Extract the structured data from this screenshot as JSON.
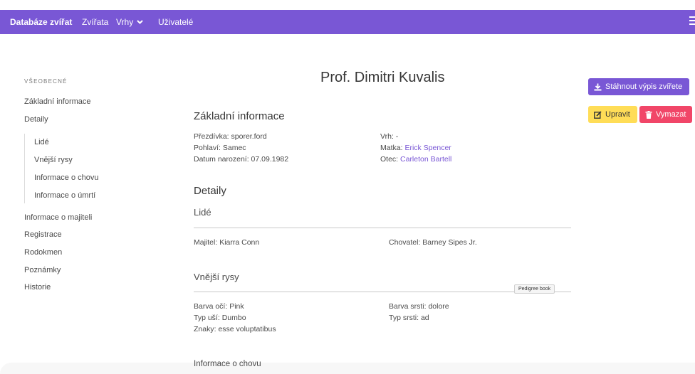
{
  "navbar": {
    "brand": "Databáze zvířat",
    "items": [
      {
        "label": "Zvířata"
      },
      {
        "label": "Vrhy"
      },
      {
        "label": "Uživatelé"
      }
    ]
  },
  "sidebar": {
    "section_label": "VŠEOBECNÉ",
    "items": [
      {
        "label": "Základní informace"
      },
      {
        "label": "Detaily"
      },
      {
        "label": "Lidé"
      },
      {
        "label": "Vnější rysy"
      },
      {
        "label": "Informace o chovu"
      },
      {
        "label": "Informace o úmrtí"
      },
      {
        "label": "Informace o majiteli"
      },
      {
        "label": "Registrace"
      },
      {
        "label": "Rodokmen"
      },
      {
        "label": "Poznámky"
      },
      {
        "label": "Historie"
      }
    ]
  },
  "main": {
    "title": "Prof. Dimitri Kuvalis",
    "basic_info": {
      "heading": "Základní informace",
      "nickname_label": "Přezdívka:",
      "nickname": "sporer.ford",
      "sex_label": "Pohlaví:",
      "sex": "Samec",
      "birth_label": "Datum narození:",
      "birth": "07.09.1982",
      "litter_label": "Vrh:",
      "litter": "-",
      "mother_label": "Matka:",
      "mother": "Erick Spencer",
      "father_label": "Otec:",
      "father": "Carleton Bartell"
    },
    "details": {
      "heading": "Detaily",
      "people": {
        "heading": "Lidé",
        "owner_label": "Majitel:",
        "owner": "Kiarra Conn",
        "breeder_label": "Chovatel:",
        "breeder": "Barney Sipes Jr."
      },
      "appearance": {
        "heading": "Vnější rysy",
        "eye_label": "Barva očí:",
        "eye": "Pink",
        "ear_label": "Typ uší:",
        "ear": "Dumbo",
        "marks_label": "Znaky:",
        "marks": "esse voluptatibus",
        "coat_color_label": "Barva srsti:",
        "coat_color": "dolore",
        "coat_type_label": "Typ srsti:",
        "coat_type": "ad"
      },
      "breeding_heading": "Informace o chovu"
    }
  },
  "actions": {
    "download": "Stáhnout výpis zvířete",
    "edit": "Upravit",
    "delete": "Vymazat"
  },
  "tooltip": "Pedigree book",
  "colors": {
    "primary": "#7957d5",
    "warning": "#ffdd57",
    "danger": "#f14668"
  }
}
